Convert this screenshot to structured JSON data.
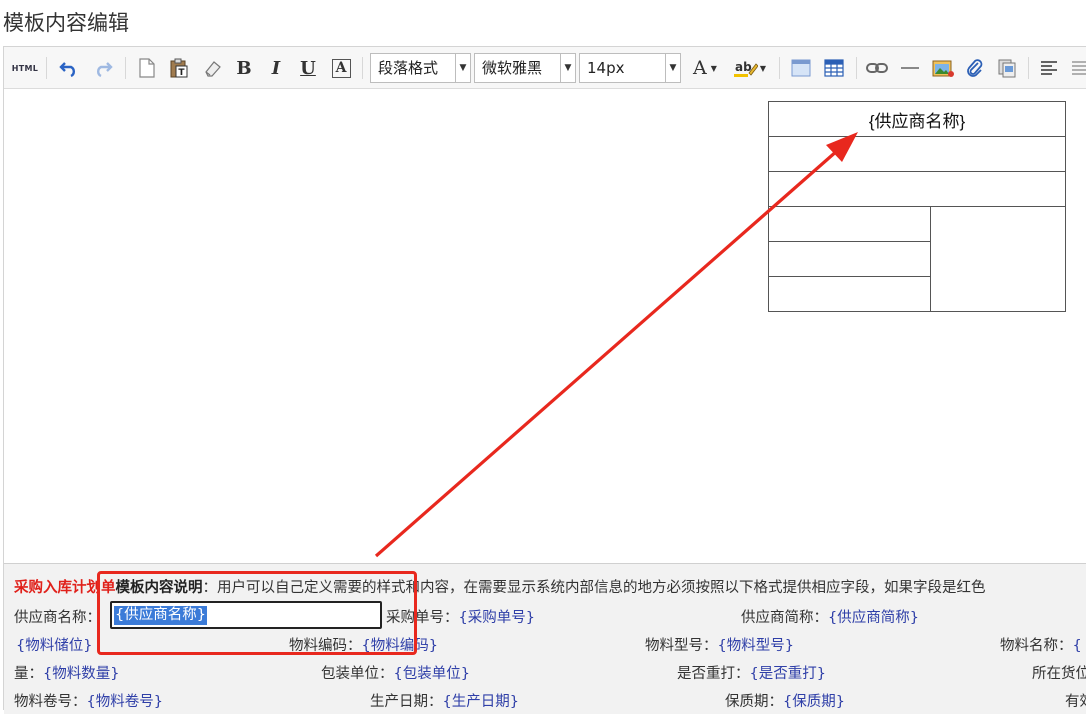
{
  "page": {
    "title": "模板内容编辑"
  },
  "toolbar": {
    "html_label": "HTML",
    "paragraph_format": "段落格式",
    "font_family": "微软雅黑",
    "font_size": "14px",
    "buttons": [
      "source-html",
      "undo",
      "redo",
      "new-document",
      "paste-text",
      "eraser",
      "bold",
      "italic",
      "underline",
      "text-frame",
      "font-color",
      "highlight-color",
      "insert-table",
      "table",
      "link",
      "horizontal-rule",
      "image",
      "attachment",
      "template",
      "align"
    ]
  },
  "editor": {
    "table_header": "{供应商名称}"
  },
  "info": {
    "prefix_red": "采购入库计划单",
    "prefix_bold": "模板内容说明",
    "description": "：用户可以自己定义需要的样式和内容，在需要显示系统内部信息的地方必须按照以下格式提供相应字段，如果字段是红色",
    "fields": [
      {
        "label": "供应商名称：",
        "value": "{供应商名称}"
      },
      {
        "label": "采购单号：",
        "value": "{采购单号}"
      },
      {
        "label": "供应商简称：",
        "value": "{供应商简称}"
      },
      {
        "label": "",
        "value": "{物料储位}"
      },
      {
        "label": "物料编码：",
        "value": "{物料编码}"
      },
      {
        "label": "物料型号：",
        "value": "{物料型号}"
      },
      {
        "label": "物料名称：",
        "value": "{"
      },
      {
        "label": "量：",
        "value": "{物料数量}"
      },
      {
        "label": "包装单位：",
        "value": "{包装单位}"
      },
      {
        "label": "是否重打：",
        "value": "{是否重打}"
      },
      {
        "label": "所在货位",
        "value": ""
      },
      {
        "label": "物料卷号：",
        "value": "{物料卷号}"
      },
      {
        "label": "生产日期：",
        "value": "{生产日期}"
      },
      {
        "label": "保质期：",
        "value": "{保质期}"
      },
      {
        "label": "有效",
        "value": ""
      }
    ]
  },
  "annotation": {
    "color": "#e8281e"
  }
}
